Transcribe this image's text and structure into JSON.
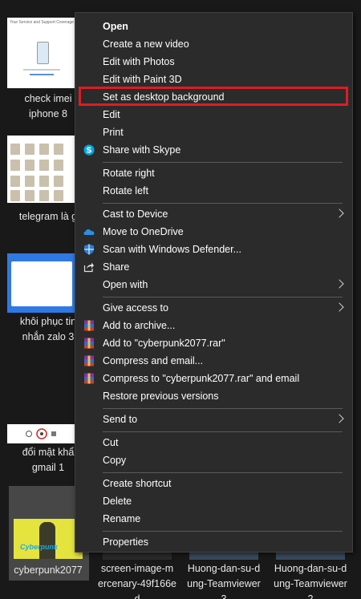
{
  "files": [
    {
      "label_lines": [
        "check imei",
        "iphone 8"
      ],
      "thumb_text": "Your Service and Support Coverage"
    },
    {
      "label_lines": [
        "telegram là g"
      ]
    },
    {
      "label_lines": [
        "khôi phục tin",
        "nhắn zalo 3"
      ]
    },
    {
      "label_lines": [
        "đổi mật khẩ",
        "gmail 1"
      ]
    },
    {
      "label_lines": [
        "cyberpunk2077"
      ],
      "selected": true
    }
  ],
  "bottom_files": [
    {
      "label_lines": [
        "screen-image-m",
        "ercenary-49f166e",
        "d"
      ]
    },
    {
      "label_lines": [
        "Huong-dan-su-d",
        "ung-Teamviewer",
        "3"
      ]
    },
    {
      "label_lines": [
        "Huong-dan-su-d",
        "ung-Teamviewer",
        "2"
      ]
    }
  ],
  "menu": {
    "items": [
      {
        "id": "open",
        "label": "Open",
        "bold": true
      },
      {
        "id": "create-video",
        "label": "Create a new video"
      },
      {
        "id": "edit-photos",
        "label": "Edit with Photos"
      },
      {
        "id": "edit-paint3d",
        "label": "Edit with Paint 3D"
      },
      {
        "id": "set-desktop-bg",
        "label": "Set as desktop background",
        "highlighted": true
      },
      {
        "id": "edit",
        "label": "Edit"
      },
      {
        "id": "print",
        "label": "Print"
      },
      {
        "id": "share-skype",
        "label": "Share with Skype",
        "icon": "skype-icon"
      },
      {
        "id": "rotate-right",
        "label": "Rotate right"
      },
      {
        "id": "rotate-left",
        "label": "Rotate left"
      },
      {
        "id": "cast",
        "label": "Cast to Device",
        "submenu": true
      },
      {
        "id": "onedrive",
        "label": "Move to OneDrive",
        "icon": "onedrive-icon"
      },
      {
        "id": "defender",
        "label": "Scan with Windows Defender...",
        "icon": "defender-shield-icon"
      },
      {
        "id": "share",
        "label": "Share",
        "icon": "share-icon"
      },
      {
        "id": "open-with",
        "label": "Open with",
        "submenu": true
      },
      {
        "id": "give-access",
        "label": "Give access to",
        "submenu": true
      },
      {
        "id": "add-archive",
        "label": "Add to archive...",
        "icon": "winrar-icon"
      },
      {
        "id": "add-rar",
        "label": "Add to \"cyberpunk2077.rar\"",
        "icon": "winrar-icon"
      },
      {
        "id": "compress-email",
        "label": "Compress and email...",
        "icon": "winrar-icon"
      },
      {
        "id": "compress-rar-email",
        "label": "Compress to \"cyberpunk2077.rar\" and email",
        "icon": "winrar-icon"
      },
      {
        "id": "restore",
        "label": "Restore previous versions"
      },
      {
        "id": "send-to",
        "label": "Send to",
        "submenu": true
      },
      {
        "id": "cut",
        "label": "Cut"
      },
      {
        "id": "copy",
        "label": "Copy"
      },
      {
        "id": "create-shortcut",
        "label": "Create shortcut"
      },
      {
        "id": "delete",
        "label": "Delete"
      },
      {
        "id": "rename",
        "label": "Rename"
      },
      {
        "id": "properties",
        "label": "Properties"
      }
    ]
  },
  "colors": {
    "menu_bg": "#2b2b2b",
    "highlight": "#e01b22",
    "desktop_bg": "#191919",
    "selected_file_bg": "#474747"
  }
}
